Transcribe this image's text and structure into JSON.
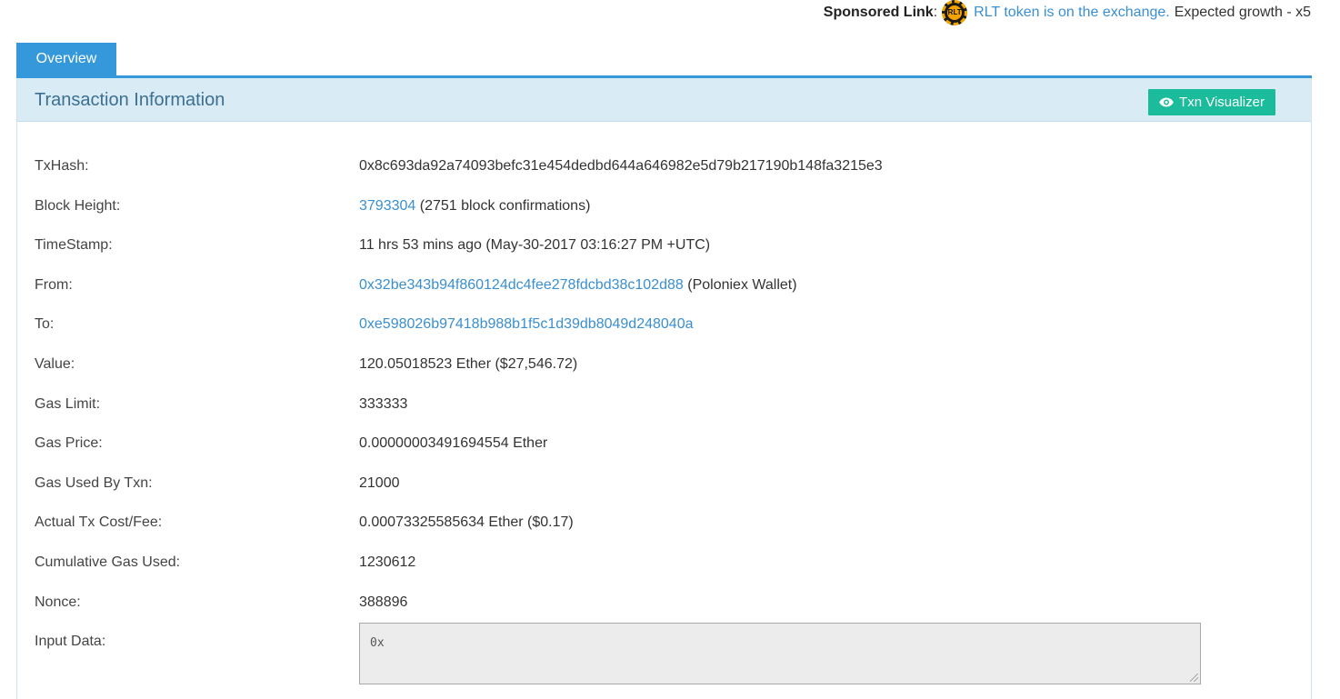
{
  "sponsor": {
    "label": "Sponsored Link",
    "colon": ":",
    "logo_text": "RLT",
    "link_text": "RLT token is on the exchange.",
    "tail_text": "Expected growth - x5"
  },
  "tabs": [
    {
      "label": "Overview"
    }
  ],
  "panel": {
    "title": "Transaction Information",
    "visualizer_label": "Txn Visualizer",
    "visualizer_icon": "eye-icon"
  },
  "details": {
    "txhash": {
      "label": "TxHash:",
      "value": "0x8c693da92a74093befc31e454dedbd644a646982e5d79b217190b148fa3215e3"
    },
    "block_height": {
      "label": "Block Height:",
      "block": "3793304",
      "confirmations": "(2751 block confirmations)"
    },
    "timestamp": {
      "label": "TimeStamp:",
      "value": "11 hrs 53 mins ago (May-30-2017 03:16:27 PM +UTC)"
    },
    "from": {
      "label": "From:",
      "address": "0x32be343b94f860124dc4fee278fdcbd38c102d88",
      "tag": "(Poloniex Wallet)"
    },
    "to": {
      "label": "To:",
      "address": "0xe598026b97418b988b1f5c1d39db8049d248040a"
    },
    "value": {
      "label": "Value:",
      "value": "120.05018523 Ether ($27,546.72)"
    },
    "gas_limit": {
      "label": "Gas Limit:",
      "value": "333333"
    },
    "gas_price": {
      "label": "Gas Price:",
      "value": "0.00000003491694554 Ether"
    },
    "gas_used": {
      "label": "Gas Used By Txn:",
      "value": "21000"
    },
    "tx_fee": {
      "label": "Actual Tx Cost/Fee:",
      "value": "0.00073325585634 Ether ($0.17)"
    },
    "cumulative_gas": {
      "label": "Cumulative Gas Used:",
      "value": "1230612"
    },
    "nonce": {
      "label": "Nonce:",
      "value": "388896"
    },
    "input_data": {
      "label": "Input Data:",
      "value": "0x"
    }
  },
  "colors": {
    "link": "#3a8fd1",
    "tab_active": "#3498db",
    "header_bg": "#d9ecf5",
    "header_title": "#3c6f91",
    "visualizer_btn": "#1abc9c"
  }
}
